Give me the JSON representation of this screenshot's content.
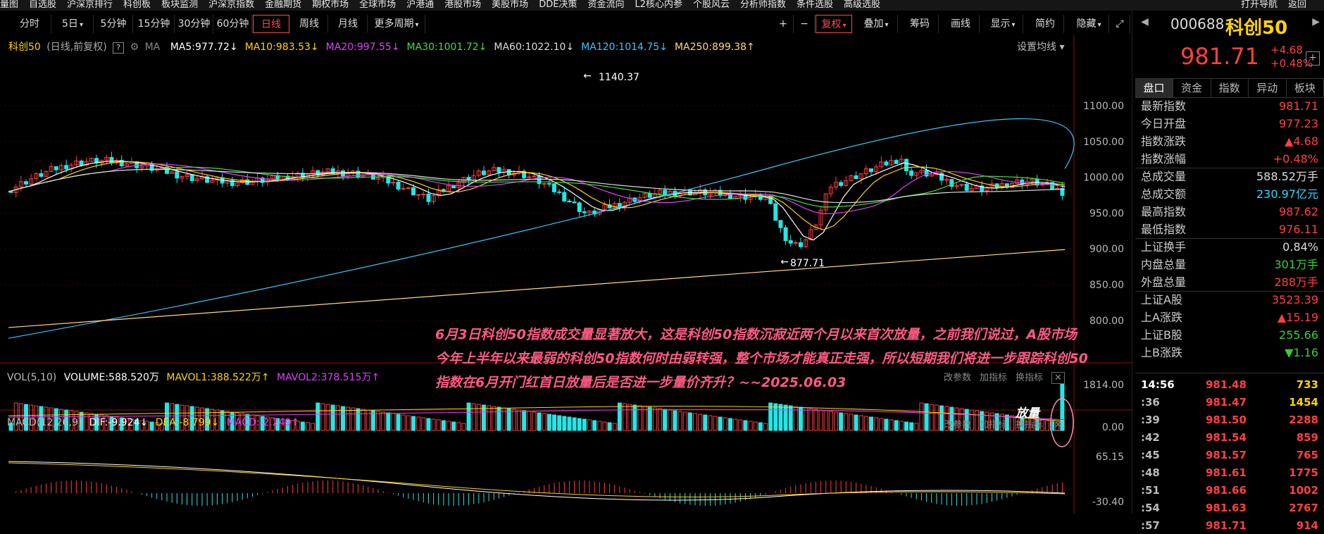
{
  "menubar": {
    "items": [
      "量图",
      "自选股",
      "沪深京排行",
      "科创板",
      "板块监测",
      "沪深京指数",
      "金融期货",
      "期权市场",
      "全球市场",
      "沪港通",
      "港股市场",
      "美股市场",
      "DDE决策",
      "资金流向",
      "L2核心内参",
      "个股风云",
      "分析师指数",
      "条件选股",
      "高级选股"
    ],
    "right": [
      "打开导航",
      "返回"
    ]
  },
  "toolbar": {
    "periods": [
      "分时",
      "5日",
      "5分钟",
      "15分钟",
      "30分钟",
      "60分钟",
      "日线",
      "周线",
      "月线",
      "更多周期"
    ],
    "active_period": "日线",
    "right_items": [
      "复权",
      "叠加",
      "筹码",
      "画线",
      "显示",
      "简约",
      "隐藏"
    ]
  },
  "chart": {
    "title": "科创50",
    "subtitle": "(日线,前复权)",
    "ma_label": "MA",
    "ma": [
      {
        "label": "MA5:977.72",
        "color": "#ffffff",
        "arrow": "↓"
      },
      {
        "label": "MA10:983.53",
        "color": "#ffd400",
        "arrow": "↓"
      },
      {
        "label": "MA20:997.55",
        "color": "#e040fb",
        "arrow": "↓"
      },
      {
        "label": "MA30:1001.72",
        "color": "#3ce03c",
        "arrow": "↓"
      },
      {
        "label": "MA60:1022.10",
        "color": "#dddddd",
        "arrow": "↓"
      },
      {
        "label": "MA120:1014.75",
        "color": "#36c6ff",
        "arrow": "↓"
      },
      {
        "label": "MA250:899.38",
        "color": "#ffd87a",
        "arrow": "↑"
      }
    ],
    "settings_label": "设置均线",
    "y_ticks": [
      "1100.00",
      "1050.00",
      "1000.00",
      "950.00",
      "900.00",
      "850.00",
      "800.00"
    ],
    "high_label": "1140.37",
    "low_label": "877.71",
    "volume": {
      "title": "VOL(5,10)",
      "volume": "VOLUME:588.520万",
      "mavol1": "MAVOL1:388.522万",
      "mavol2": "MAVOL2:378.515万",
      "y_ticks": [
        "1814.00",
        "0.00"
      ],
      "tag": "放量",
      "buttons": [
        "改参数",
        "加指标",
        "换指标"
      ]
    },
    "macd": {
      "title": "MACD(12,26,9)",
      "dif": "DIF:-9.924",
      "dea": "DEA:-8.799",
      "macd": "MACD:-2.249",
      "y_ticks": [
        "65.15",
        "-30.40"
      ],
      "buttons": [
        "改参数",
        "加指标",
        "换指标"
      ]
    },
    "annotation": "6月3日科创50指数成交量显著放大，这是科创50指数沉寂近两个月以来首次放量，之前我们说过，A股市场今年上半年以来最弱的科创50指数何时由弱转强，整个市场才能真正走强，所以短期我们将进一步跟踪科创50指数在6月开门红首日放量后是否进一步量价齐升？~~2025.06.03"
  },
  "quote": {
    "code": "000688",
    "name": "科创50",
    "price": "981.71",
    "change": "+4.68",
    "change_pct": "+0.48%",
    "tabs": [
      "盘口",
      "资金",
      "指数",
      "异动",
      "板块"
    ],
    "stats": [
      {
        "k": "最新指数",
        "v": "981.71",
        "c": "up"
      },
      {
        "k": "今日开盘",
        "v": "977.23",
        "c": "up"
      },
      {
        "k": "指数涨跌",
        "v": "▲4.68",
        "c": "up"
      },
      {
        "k": "指数涨幅",
        "v": "+0.48%",
        "c": "up"
      },
      {
        "k": "总成交量",
        "v": "588.52万手",
        "c": "normal"
      },
      {
        "k": "总成交额",
        "v": "230.97亿元",
        "c": "cyan"
      },
      {
        "k": "最高指数",
        "v": "987.62",
        "c": "up"
      },
      {
        "k": "最低指数",
        "v": "976.11",
        "c": "up"
      },
      {
        "k": "上证换手",
        "v": "0.84%",
        "c": "normal"
      },
      {
        "k": "内盘总量",
        "v": "301万手",
        "c": "down"
      },
      {
        "k": "外盘总量",
        "v": "288万手",
        "c": "up"
      },
      {
        "k": "上证A股",
        "v": "3523.39",
        "c": "up"
      },
      {
        "k": "上A涨跌",
        "v": "▲15.19",
        "c": "up"
      },
      {
        "k": "上证B股",
        "v": "255.66",
        "c": "down"
      },
      {
        "k": "上B涨跌",
        "v": "▼1.16",
        "c": "down"
      }
    ],
    "ticks": [
      {
        "t": "14:56",
        "p": "981.48",
        "v": "733"
      },
      {
        "t": ":36",
        "p": "981.47",
        "v": "1454"
      },
      {
        "t": ":39",
        "p": "981.50",
        "v": "2288"
      },
      {
        "t": ":42",
        "p": "981.54",
        "v": "859"
      },
      {
        "t": ":45",
        "p": "981.57",
        "v": "765"
      },
      {
        "t": ":48",
        "p": "981.61",
        "v": "1775"
      },
      {
        "t": ":51",
        "p": "981.66",
        "v": "1002"
      },
      {
        "t": ":54",
        "p": "981.63",
        "v": "2767"
      },
      {
        "t": ":57",
        "p": "981.71",
        "v": "914"
      }
    ]
  }
}
